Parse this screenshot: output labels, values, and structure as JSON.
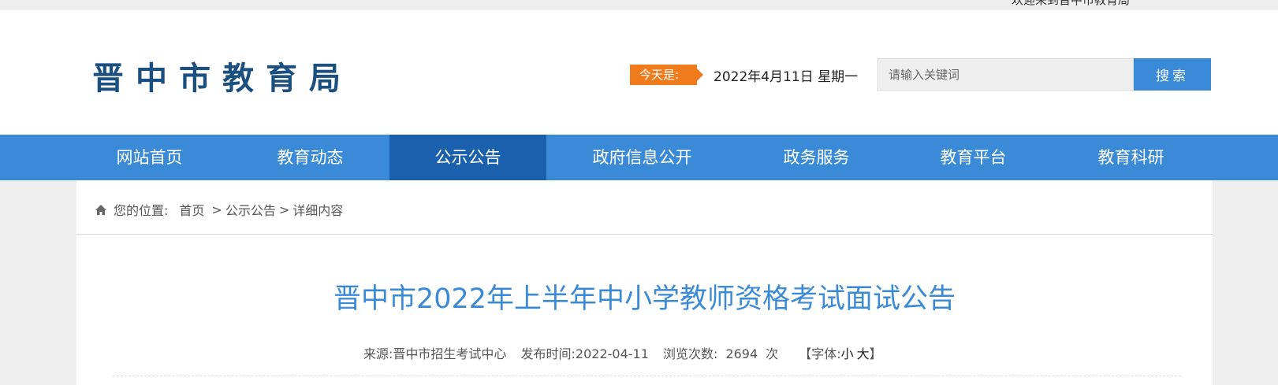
{
  "topbar": {
    "welcome_text": "欢迎来到晋中市教育局"
  },
  "header": {
    "logo_text": "晋中市教育局",
    "today_label": "今天是:",
    "today_date": "2022年4月11日 星期一",
    "search": {
      "placeholder": "请输入关键词",
      "button_label": "搜索"
    },
    "colors": {
      "accent": "#3a8ad7",
      "badge": "#f07b1c",
      "logo": "#1b4f80",
      "nav_active": "#1a60ac"
    }
  },
  "nav": {
    "items": [
      {
        "label": "网站首页"
      },
      {
        "label": "教育动态"
      },
      {
        "label": "公示公告",
        "active": true
      },
      {
        "label": "政府信息公开"
      },
      {
        "label": "政务服务"
      },
      {
        "label": "教育平台"
      },
      {
        "label": "教育科研"
      }
    ]
  },
  "breadcrumb": {
    "icon": "home-icon",
    "prefix": "您的位置:",
    "items": [
      "首页",
      "公示公告",
      "详细内容"
    ],
    "separator": ">"
  },
  "article": {
    "title": "晋中市2022年上半年中小学教师资格考试面试公告",
    "meta": {
      "source_label": "来源:",
      "source": "晋中市招生考试中心",
      "publish_label": "发布时间:",
      "publish_date": "2022-04-11",
      "views_label": "浏览次数:",
      "views": "2694",
      "views_unit": "次",
      "font_label": "【字体:",
      "font_small": "小",
      "font_large": "大",
      "font_close": "】"
    }
  }
}
